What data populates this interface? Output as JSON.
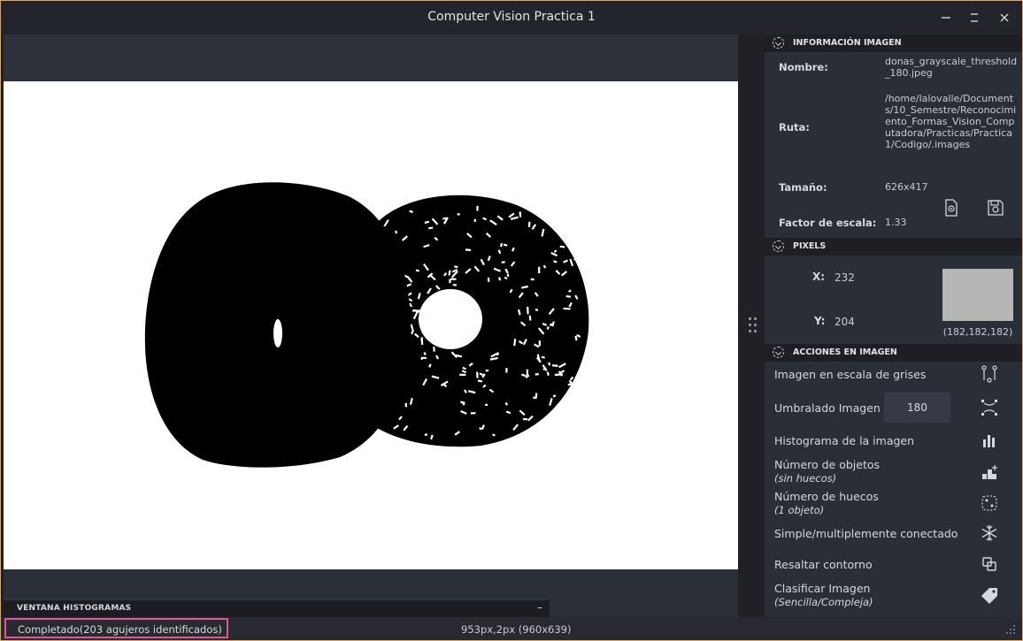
{
  "window": {
    "title": "Computer Vision Practica 1"
  },
  "info": {
    "header": "INFORMACIÓN IMAGEN",
    "name_label": "Nombre:",
    "name_value": "donas_grayscale_threshold_180.jpeg",
    "path_label": "Ruta:",
    "path_value": "/home/lalovalle/Documents/10_Semestre/Reconocimiento_Formas_Vision_Computadora/Practicas/Practica1/Codigo/.images",
    "size_label": "Tamaño:",
    "size_value": "626x417",
    "scale_label": "Factor de escala:",
    "scale_value": "1.33"
  },
  "pixels": {
    "header": "PIXELS",
    "x_label": "X:",
    "x_value": "232",
    "y_label": "Y:",
    "y_value": "204",
    "rgb_label": "(182,182,182)",
    "swatch_color": "#b6b6b6"
  },
  "actions": {
    "header": "ACCIONES EN IMAGEN",
    "grayscale": "Imagen en escala de grises",
    "threshold": "Umbralado Imagen",
    "threshold_value": "180",
    "histogram": "Histograma de la imagen",
    "objects": "Número de objetos",
    "objects_sub": "(sin huecos)",
    "holes": "Número de huecos",
    "holes_sub": "(1 objeto)",
    "connected": "Simple/multiplemente conectado",
    "contour": "Resaltar contorno",
    "classify": "Clasificar Imagen",
    "classify_sub": "(Sencilla/Compleja)"
  },
  "histogram_dock": {
    "title": "VENTANA HISTOGRAMAS",
    "minimize": "–"
  },
  "status": {
    "message": "Completado(203 agujeros identificados)",
    "coords": "953px,2px (960x639)"
  },
  "icons": {
    "minimize": "minimize-icon",
    "maximize": "maximize-icon",
    "close": "close-icon",
    "colors": {
      "accent_highlight": "#e0579c",
      "window_border": "#eca15a",
      "panel_bg": "#2a2e36"
    }
  }
}
